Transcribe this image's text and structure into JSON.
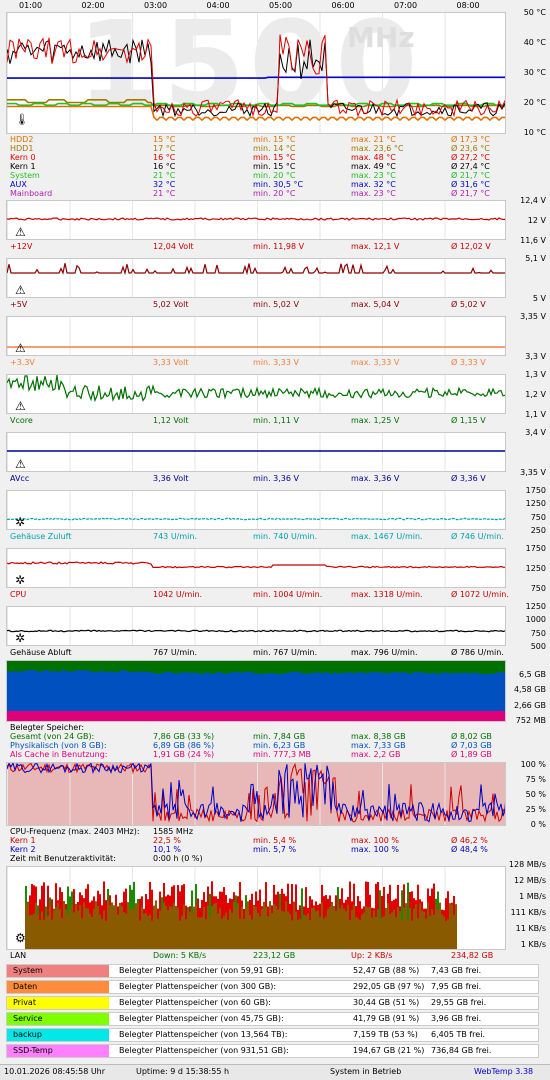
{
  "hours": [
    "01:00",
    "02:00",
    "03:00",
    "04:00",
    "05:00",
    "06:00",
    "07:00",
    "08:00"
  ],
  "temp": {
    "axis": [
      "50 °C",
      "40 °C",
      "30 °C",
      "20 °C",
      "10 °C"
    ],
    "watermark": "1500",
    "watermark_unit": "MHz",
    "rows": [
      {
        "name": "HDD2",
        "cur": "15 °C",
        "min": "min. 15 °C",
        "max": "max. 21 °C",
        "avg": "Ø 17,3 °C",
        "color": "#e07000"
      },
      {
        "name": "HDD1",
        "cur": "17 °C",
        "min": "min. 14 °C",
        "max": "max. 23,6 °C",
        "avg": "Ø 23,6 °C",
        "color": "#a07800"
      },
      {
        "name": "Kern 0",
        "cur": "16 °C",
        "min": "min. 15 °C",
        "max": "max. 48 °C",
        "avg": "Ø 27,2 °C",
        "color": "#e00000"
      },
      {
        "name": "Kern 1",
        "cur": "16 °C",
        "min": "min. 15 °C",
        "max": "max. 49 °C",
        "avg": "Ø 27,4 °C",
        "color": "#000000"
      },
      {
        "name": "System",
        "cur": "21 °C",
        "min": "min. 20 °C",
        "max": "max. 23 °C",
        "avg": "Ø 21,7 °C",
        "color": "#22c022"
      },
      {
        "name": "AUX",
        "cur": "32 °C",
        "min": "min. 30,5 °C",
        "max": "max. 32 °C",
        "avg": "Ø 31,6 °C",
        "color": "#0000c8"
      },
      {
        "name": "Mainboard",
        "cur": "21 °C",
        "min": "min. 20 °C",
        "max": "max. 23 °C",
        "avg": "Ø 21,7 °C",
        "color": "#b020b0"
      }
    ]
  },
  "volts": [
    {
      "axis": [
        "12,4 V",
        "12 V",
        "11,6 V"
      ],
      "name": "+12V",
      "cur": "12,04 Volt",
      "min": "min. 11,98 V",
      "max": "max. 12,1 V",
      "avg": "Ø 12,02 V",
      "color": "#cc0000",
      "level": 0.55,
      "noise": "low"
    },
    {
      "axis": [
        "5,1 V",
        "5 V"
      ],
      "name": "+5V",
      "cur": "5,02 Volt",
      "min": "min. 5,02 V",
      "max": "max. 5,04 V",
      "avg": "Ø 5,02 V",
      "color": "#8b0000",
      "level": 0.65,
      "noise": "spiky"
    },
    {
      "axis": [
        "3,35 V",
        "3,3 V"
      ],
      "name": "+3.3V",
      "cur": "3,33 Volt",
      "min": "min. 3,33 V",
      "max": "max. 3,33 V",
      "avg": "Ø 3,33 V",
      "color": "#f08040",
      "level": 0.25,
      "noise": "flat"
    },
    {
      "axis": [
        "1,3 V",
        "1,2 V",
        "1,1 V"
      ],
      "name": "Vcore",
      "cur": "1,12 Volt",
      "min": "min. 1,11 V",
      "max": "max. 1,25 V",
      "avg": "Ø 1,15 V",
      "color": "#007000",
      "level": 0.55,
      "noise": "high"
    },
    {
      "axis": [
        "3,4 V",
        "3,35 V"
      ],
      "name": "AVcc",
      "cur": "3,36 Volt",
      "min": "min. 3,36 V",
      "max": "max. 3,36 V",
      "avg": "Ø 3,36 V",
      "color": "#000090",
      "level": 0.55,
      "noise": "flat"
    }
  ],
  "fans": [
    {
      "axis": [
        "1750",
        "1250",
        "750",
        "250"
      ],
      "name": "Gehäuse Zuluft",
      "cur": "743 U/min.",
      "min": "min. 740 U/min.",
      "max": "max. 1467 U/min.",
      "avg": "Ø 746 U/min.",
      "color": "#00a0b0"
    },
    {
      "axis": [
        "1750",
        "1250",
        "750"
      ],
      "name": "CPU",
      "cur": "1042 U/min.",
      "min": "min. 1004 U/min.",
      "max": "max. 1318 U/min.",
      "avg": "Ø 1072 U/min.",
      "color": "#cc0000"
    },
    {
      "axis": [
        "1250",
        "1000",
        "750",
        "500"
      ],
      "name": "Gehäuse Abluft",
      "cur": "767 U/min.",
      "min": "min. 767 U/min.",
      "max": "max. 796 U/min.",
      "avg": "Ø 786 U/min.",
      "color": "#000000"
    }
  ],
  "memory": {
    "axis": [
      "6,5 GB",
      "4,58 GB",
      "2,66 GB",
      "752 MB"
    ],
    "title": "Belegter Speicher:",
    "rows": [
      {
        "name": "Gesamt (von 24 GB):",
        "cur": "7,86 GB (33 %)",
        "min": "min. 7,84 GB",
        "max": "max. 8,38 GB",
        "avg": "Ø 8,02 GB",
        "color": "#007000"
      },
      {
        "name": "Physikalisch (von 8 GB):",
        "cur": "6,89 GB (86 %)",
        "min": "min. 6,23 GB",
        "max": "max. 7,33 GB",
        "avg": "Ø 7,03 GB",
        "color": "#0050c0"
      },
      {
        "name": "Als Cache in Benutzung:",
        "cur": "1,91 GB (24 %)",
        "min": "min. 777,3 MB",
        "max": "max. 2,2 GB",
        "avg": "Ø 1,89 GB",
        "color": "#e0007a"
      }
    ]
  },
  "cpu": {
    "axis": [
      "100 %",
      "75 %",
      "50 %",
      "25 %",
      "0 %"
    ],
    "title": "CPU-Frequenz (max. 2403 MHz):",
    "freq": "1585 MHz",
    "rows": [
      {
        "name": "Kern 1",
        "cur": "22,5 %",
        "min": "min. 5,4 %",
        "max": "max. 100 %",
        "avg": "Ø 46,2 %",
        "color": "#cc0000"
      },
      {
        "name": "Kern 2",
        "cur": "10,1 %",
        "min": "min. 5,7 %",
        "max": "max. 100 %",
        "avg": "Ø 48,4 %",
        "color": "#0000c0"
      }
    ],
    "idle_label": "Zeit mit Benutzeraktivität:",
    "idle_val": "0:00 h (0 %)"
  },
  "lan": {
    "axis": [
      "128 MB/s",
      "12 MB/s",
      "1 MB/s",
      "111 KB/s",
      "11 KB/s",
      "1 KB/s"
    ],
    "name": "LAN",
    "down": "Down: 5 KB/s",
    "down_total": "223,12 GB",
    "up": "Up: 2 KB/s",
    "up_total": "234,82 GB"
  },
  "drives": [
    {
      "name": "System",
      "color": "#f08080",
      "label": "Belegter Plattenspeicher (von 59,91 GB):",
      "used": "52,47 GB (88 %)",
      "free": "7,43 GB frei."
    },
    {
      "name": "Daten",
      "color": "#ff8c3c",
      "label": "Belegter Plattenspeicher (von 300 GB):",
      "used": "292,05 GB (97 %)",
      "free": "7,95 GB frei."
    },
    {
      "name": "Privat",
      "color": "#ffff00",
      "label": "Belegter Plattenspeicher (von 60 GB):",
      "used": "30,44 GB (51 %)",
      "free": "29,55 GB frei."
    },
    {
      "name": "Service",
      "color": "#80ff00",
      "label": "Belegter Plattenspeicher (von 45,75 GB):",
      "used": "41,79 GB (91 %)",
      "free": "3,96 GB frei."
    },
    {
      "name": "backup",
      "color": "#00e8e8",
      "label": "Belegter Plattenspeicher (von 13,564 TB):",
      "used": "7,159 TB (53 %)",
      "free": "6,405 TB frei."
    },
    {
      "name": "SSD-Temp",
      "color": "#ff80ff",
      "label": "Belegter Plattenspeicher (von 931,51 GB):",
      "used": "194,67 GB (21 %)",
      "free": "736,84 GB frei."
    }
  ],
  "status": {
    "datetime": "10.01.2026 08:45:58 Uhr",
    "uptime": "Uptime: 9 d 15:38:55 h",
    "state": "System in Betrieb",
    "app": "WebTemp 3.38"
  }
}
